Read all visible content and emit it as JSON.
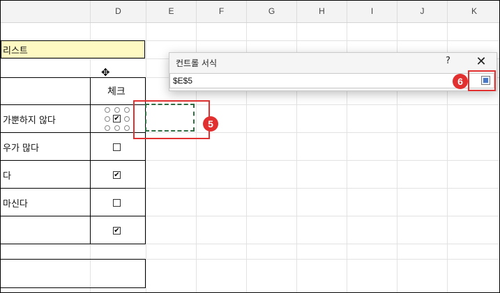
{
  "columns": [
    "D",
    "E",
    "F",
    "G",
    "H",
    "I",
    "J",
    "K"
  ],
  "cells": {
    "title": "리스트",
    "header_check": "체크",
    "row1": "가뿐하지 않다",
    "row2": "우가 많다",
    "row3": "다",
    "row4": "마신다"
  },
  "checkboxes": [
    true,
    false,
    true,
    false,
    true
  ],
  "dialog": {
    "title": "컨트롤 서식",
    "help": "?",
    "close": "✕",
    "cell_link_value": "$E$5"
  },
  "callouts": [
    "5",
    "6"
  ],
  "colors": {
    "callout_red": "#e23030",
    "highlight_yellow": "#fef9c3",
    "marching_ants": "#2f6e43"
  }
}
